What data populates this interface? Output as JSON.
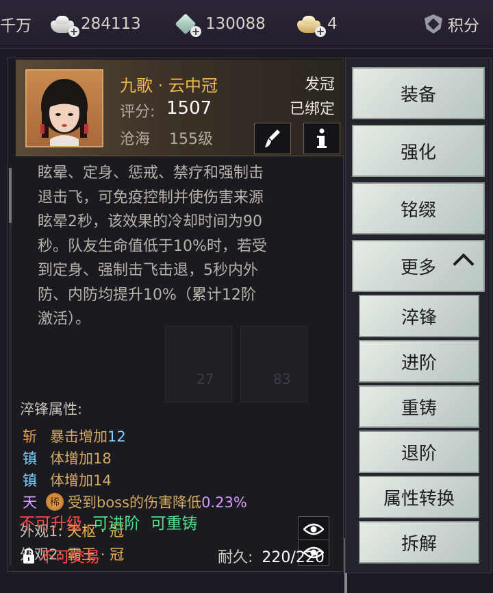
{
  "topbar": {
    "partial_label": "千万",
    "currency1": "284113",
    "currency2": "130088",
    "currency3": "4",
    "points_label": "积分"
  },
  "item": {
    "name": "九歌 · 云中冠",
    "type": "发冠",
    "bound": "已绑定",
    "score_label": "评分:",
    "score": "1507",
    "source": "沧海",
    "level": "155级",
    "bg_numbers": [
      "27",
      "83"
    ]
  },
  "description": [
    "眩晕、定身、惩戒、禁疗和强制击",
    "退击飞，可免疫控制并使伤害来源",
    "眩晕2秒，该效果的冷却时间为90",
    "秒。队友生命值低于10%时，若受",
    "到定身、强制击飞击退，5秒内外",
    "防、内防均提升10%（累计12阶",
    "激活）。"
  ],
  "temper": {
    "title": "淬锋属性:",
    "rows": [
      {
        "tag": "斩",
        "tag_color": "#f0a050",
        "text": "暴击增加",
        "num": "12",
        "num_class": "blue"
      },
      {
        "tag": "镇",
        "tag_color": "#7fd0ff",
        "text": "体增加",
        "num": "18",
        "num_class": "gold"
      },
      {
        "tag": "镇",
        "tag_color": "#7fd0ff",
        "text": "体增加",
        "num": "14",
        "num_class": "gold"
      },
      {
        "tag": "天",
        "tag_color": "#d79bff",
        "badge": "稀",
        "text": "受到boss的伤害降低",
        "num": "0.23%",
        "num_class": "purple"
      }
    ]
  },
  "appearance": [
    {
      "label": "外观1:",
      "value": "天枢 · 冠"
    },
    {
      "label": "外观2:",
      "value": "霸王 · 冠"
    }
  ],
  "status": {
    "not_upgradable": "不可升级",
    "can_advance": "可进阶",
    "can_reforge": "可重铸"
  },
  "footer": {
    "trade": "不可交易",
    "durability_label": "耐久:",
    "durability": "220/220"
  },
  "actions": {
    "equip": "装备",
    "enhance": "强化",
    "inscribe": "铭缀",
    "more": "更多",
    "temper": "淬锋",
    "advance": "进阶",
    "reforge": "重铸",
    "degrade": "退阶",
    "convert": "属性转换",
    "dismantle": "拆解"
  }
}
